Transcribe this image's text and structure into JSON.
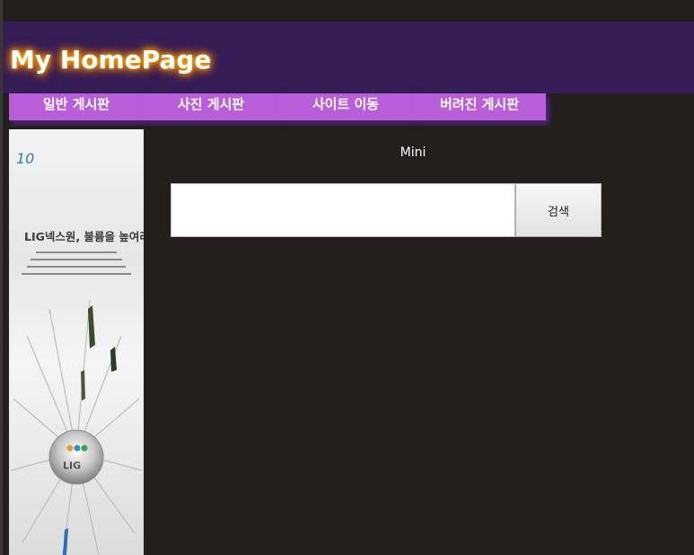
{
  "header": {
    "title": "My HomePage"
  },
  "nav": {
    "items": [
      {
        "label": "일반 게시판"
      },
      {
        "label": "사진 게시판"
      },
      {
        "label": "사이트 이동"
      },
      {
        "label": "버려진 게시판"
      }
    ]
  },
  "ad": {
    "headline": "LIG넥스원, 불륨을 높여라",
    "logo_text": "LIG",
    "badge_text": "10"
  },
  "main": {
    "mini_label": "Mini",
    "search": {
      "value": "",
      "button_label": "검색"
    }
  },
  "colors": {
    "background": "#231f1f",
    "header_bg": "#351c55",
    "nav_bg": "#b85ed9",
    "title_glow": "#ff9800"
  }
}
